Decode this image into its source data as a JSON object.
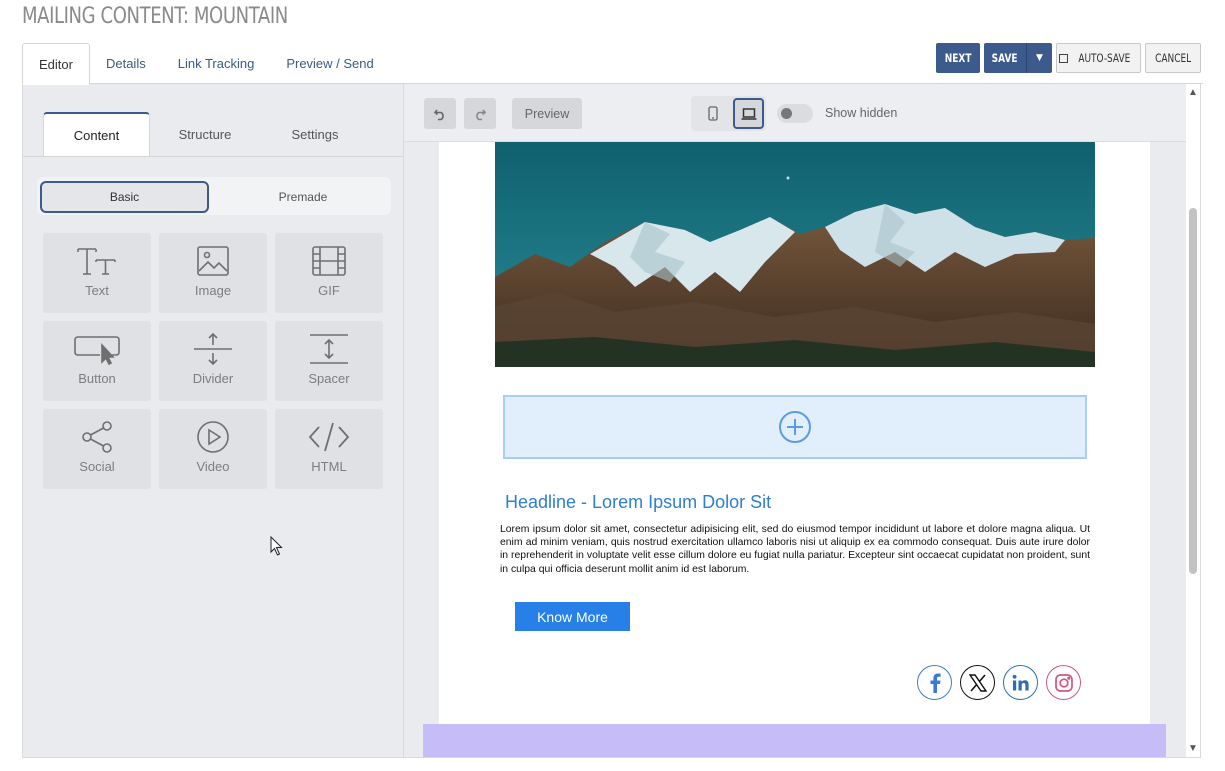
{
  "page": {
    "title": "MAILING CONTENT: MOUNTAIN"
  },
  "tabs": [
    {
      "label": "Editor",
      "active": true
    },
    {
      "label": "Details"
    },
    {
      "label": "Link Tracking"
    },
    {
      "label": "Preview / Send"
    }
  ],
  "actions": {
    "next": "NEXT",
    "save": "SAVE",
    "auto_save": "AUTO-SAVE",
    "cancel": "CANCEL"
  },
  "panel": {
    "tabs": [
      {
        "label": "Content",
        "active": true
      },
      {
        "label": "Structure"
      },
      {
        "label": "Settings"
      }
    ],
    "segment": {
      "basic": "Basic",
      "premade": "Premade",
      "selected": "Basic"
    },
    "blocks": [
      {
        "label": "Text",
        "icon": "text-icon"
      },
      {
        "label": "Image",
        "icon": "image-icon"
      },
      {
        "label": "GIF",
        "icon": "gif-icon"
      },
      {
        "label": "Button",
        "icon": "button-icon"
      },
      {
        "label": "Divider",
        "icon": "divider-icon"
      },
      {
        "label": "Spacer",
        "icon": "spacer-icon"
      },
      {
        "label": "Social",
        "icon": "share-icon"
      },
      {
        "label": "Video",
        "icon": "play-icon"
      },
      {
        "label": "HTML",
        "icon": "code-icon"
      }
    ]
  },
  "toolbar": {
    "preview": "Preview",
    "show_hidden": "Show hidden",
    "show_hidden_on": false,
    "device_selected": "desktop"
  },
  "email": {
    "headline": "Headline - Lorem Ipsum Dolor Sit",
    "body": "Lorem ipsum dolor sit amet, consectetur adipisicing elit, sed do eiusmod tempor incididunt ut labore et dolore magna aliqua. Ut enim ad minim veniam, quis nostrud exercitation ullamco laboris nisi ut aliquip ex ea commodo consequat. Duis aute irure dolor in reprehenderit in voluptate velit esse cillum dolore eu fugiat nulla pariatur. Excepteur sint occaecat cupidatat non proident, sunt in culpa qui officia deserunt mollit anim id est laborum.",
    "cta": "Know More",
    "socials": [
      "facebook-icon",
      "x-icon",
      "linkedin-icon",
      "instagram-icon"
    ]
  },
  "colors": {
    "primary": "#3d5a8c",
    "headline": "#2f7ecf",
    "cta": "#2680e8",
    "band": "#c5bcf8"
  }
}
